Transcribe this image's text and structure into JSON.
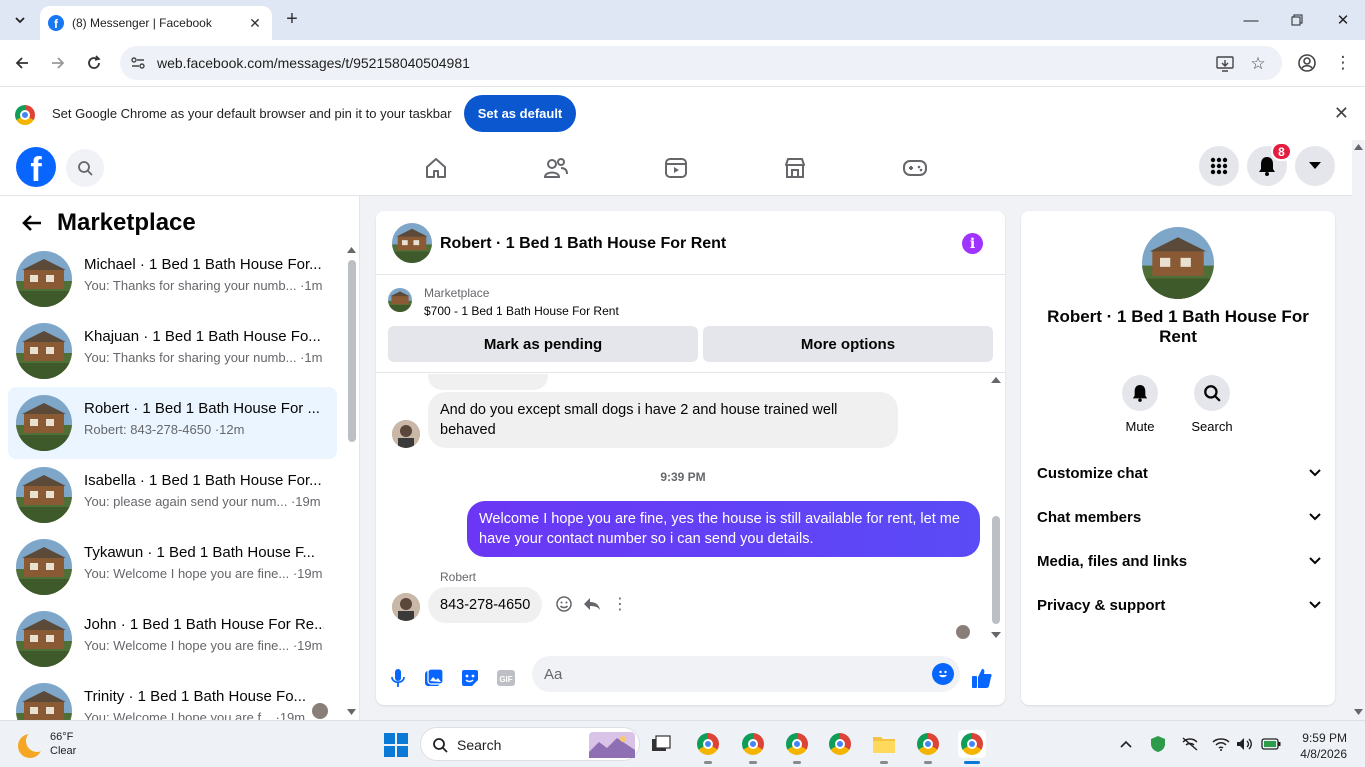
{
  "browser": {
    "tab_title": "(8) Messenger | Facebook",
    "url": "web.facebook.com/messages/t/952158040504981",
    "infobar_message": "Set Google Chrome as your default browser and pin it to your taskbar",
    "infobar_button": "Set as default"
  },
  "fb": {
    "notification_count": "8",
    "brand_color": "#0866ff"
  },
  "sidebar": {
    "title": "Marketplace",
    "chats": [
      {
        "name": "Michael · 1 Bed 1 Bath House For...",
        "preview": "You: Thanks for sharing your numb... ·1m"
      },
      {
        "name": "Khajuan · 1 Bed 1 Bath House Fo...",
        "preview": "You: Thanks for sharing your numb... ·1m"
      },
      {
        "name": "Robert · 1 Bed 1 Bath House For ...",
        "preview": "Robert: 843-278-4650 ·12m"
      },
      {
        "name": "Isabella · 1 Bed 1 Bath House For...",
        "preview": "You: please again send your num... ·19m"
      },
      {
        "name": "Tykawun · 1 Bed 1 Bath House F...",
        "preview": "You: Welcome I hope you are fine... ·19m"
      },
      {
        "name": "John · 1 Bed 1 Bath House For Re...",
        "preview": "You: Welcome I hope you are fine... ·19m"
      },
      {
        "name": "Trinity · 1 Bed 1 Bath House Fo...",
        "preview": "You: Welcome I hope you are f... ·19m"
      }
    ]
  },
  "conversation": {
    "title": "Robert · 1 Bed 1 Bath House For Rent",
    "marketplace_label": "Marketplace",
    "listing": "$700 - 1 Bed 1 Bath House For Rent",
    "mark_pending": "Mark as pending",
    "more_options": "More options",
    "messages": {
      "incoming_1": "And do you except small dogs i have 2 and house trained well behaved",
      "timestamp": "9:39 PM",
      "outgoing_1": "Welcome I hope you are fine, yes the house is still available for rent, let me have your contact number so i can send you  details.",
      "sender_name": "Robert",
      "incoming_2": "843-278-4650"
    },
    "composer_placeholder": "Aa",
    "outgoing_color": "#6236f5"
  },
  "info_panel": {
    "name": "Robert · 1 Bed 1 Bath House For Rent",
    "mute": "Mute",
    "search": "Search",
    "sections": [
      "Customize chat",
      "Chat members",
      "Media, files and links",
      "Privacy & support"
    ]
  },
  "taskbar": {
    "temp": "66°F",
    "condition": "Clear",
    "search": "Search",
    "time": "9:59 PM",
    "date": "4/8/2026"
  }
}
